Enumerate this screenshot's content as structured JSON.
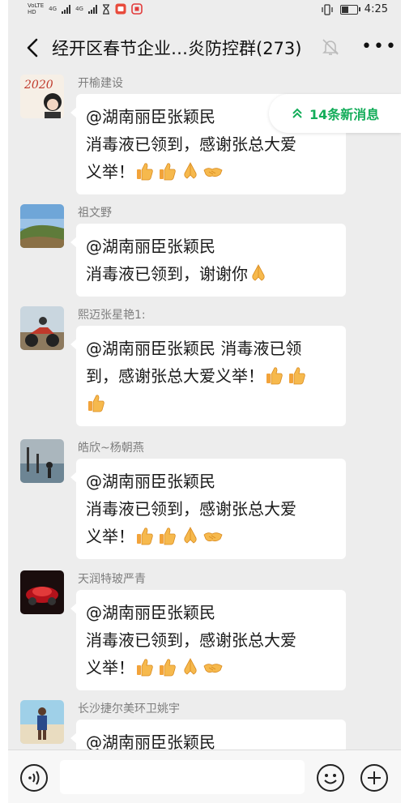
{
  "status_bar": {
    "net_tags": [
      "VoLTE",
      "HD"
    ],
    "network_1": "4G",
    "network_2": "4G",
    "time": "4:25"
  },
  "header": {
    "title": "经开区春节企业…炎防控群(273)"
  },
  "new_messages_badge": "14条新消息",
  "messages": [
    {
      "sender": "开榆建设",
      "lines": [
        "@湖南丽臣张颖民",
        " 消毒液已领到，感谢张总大爱",
        "义举！"
      ],
      "avatar_text": "2020"
    },
    {
      "sender": "祖文野",
      "lines": [
        "@湖南丽臣张颖民",
        " 消毒液已领到，谢谢你"
      ]
    },
    {
      "sender": "熙迈张星艳1:",
      "lines": [
        "@湖南丽臣张颖民  消毒液已领",
        "到，感谢张总大爱义举！",
        ""
      ]
    },
    {
      "sender": "皓欣~杨朝燕",
      "lines": [
        "@湖南丽臣张颖民",
        " 消毒液已领到，感谢张总大爱",
        "义举！"
      ]
    },
    {
      "sender": "天润特玻严青",
      "lines": [
        "@湖南丽臣张颖民",
        " 消毒液已领到，感谢张总大爱",
        "义举！"
      ]
    },
    {
      "sender": "长沙捷尔美环卫姚宇",
      "lines": [
        "@湖南丽臣张颖民"
      ]
    }
  ]
}
